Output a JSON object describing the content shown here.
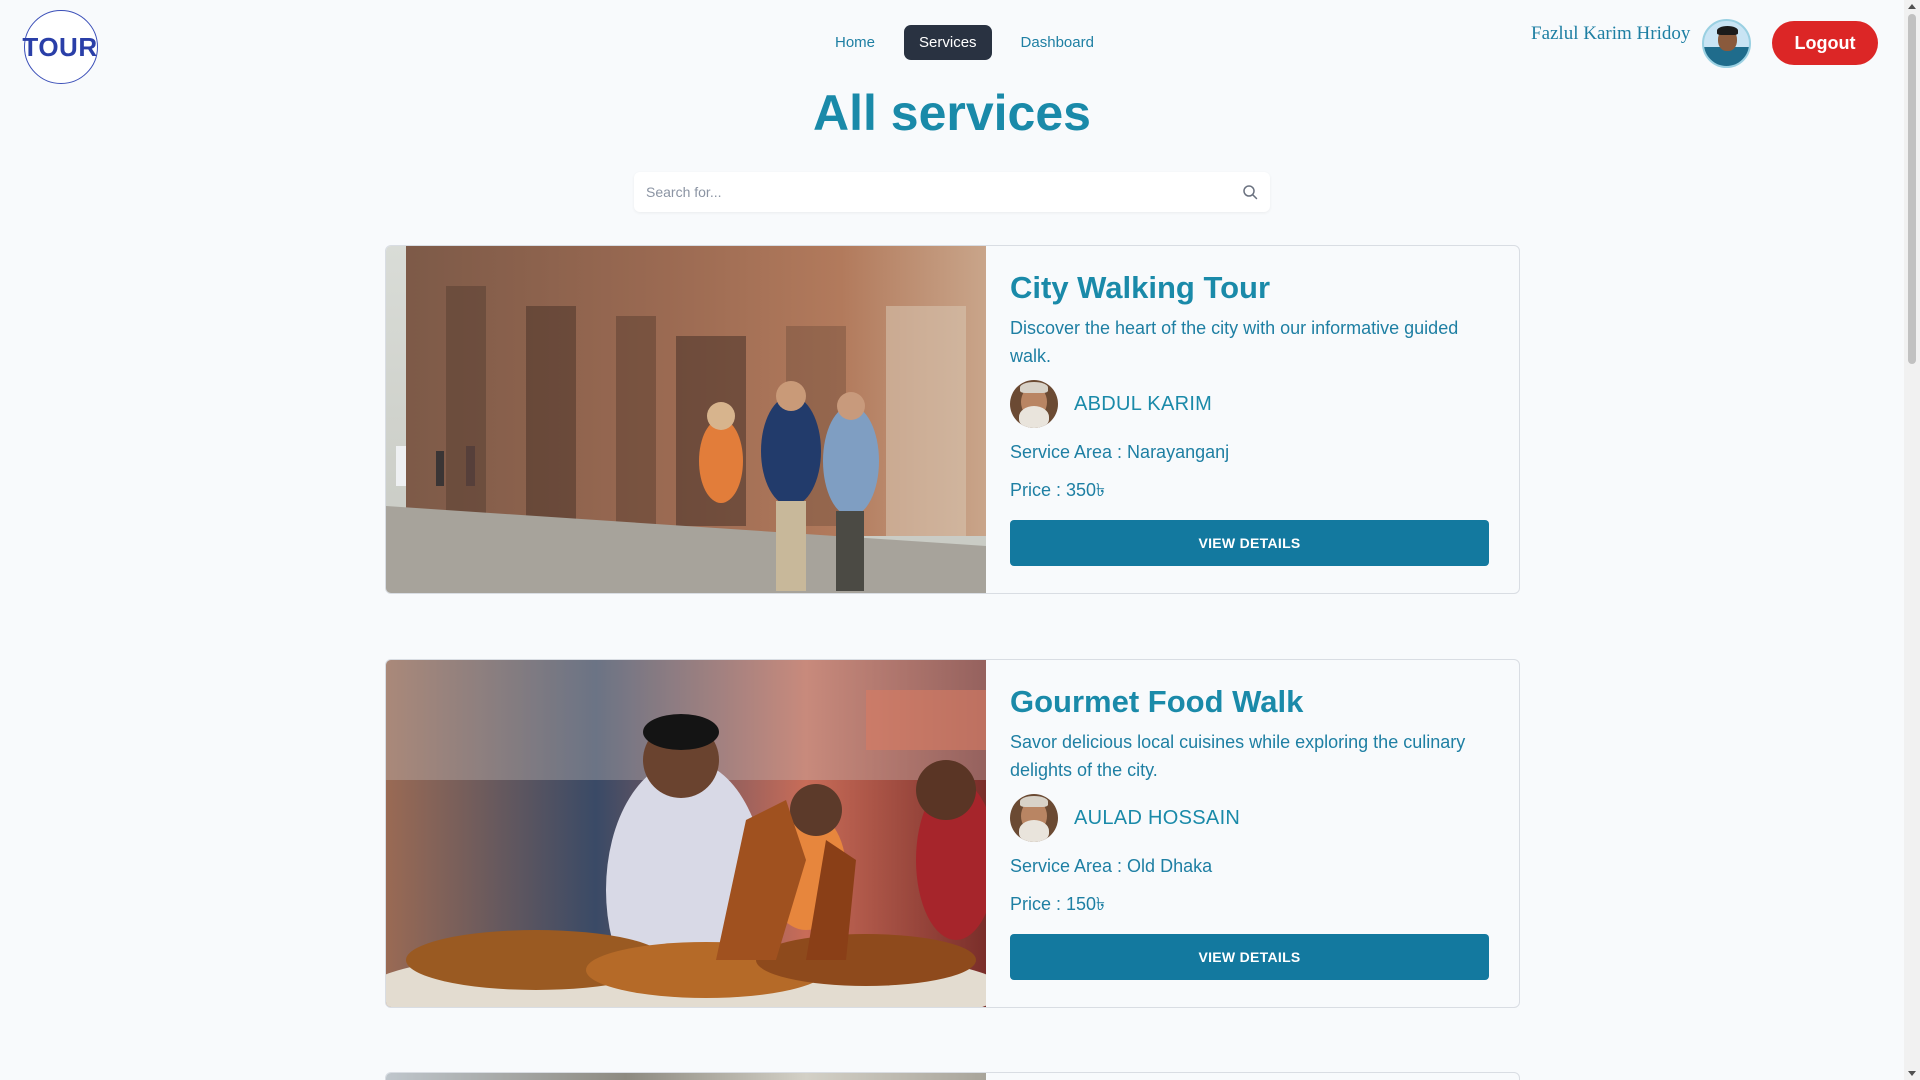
{
  "header": {
    "logo_text": "TOUR",
    "nav": [
      {
        "label": "Home",
        "active": false
      },
      {
        "label": "Services",
        "active": true
      },
      {
        "label": "Dashboard",
        "active": false
      }
    ],
    "user_name": "Fazlul Karim Hridoy",
    "logout_label": "Logout"
  },
  "page_title": "All services",
  "search": {
    "placeholder": "Search for...",
    "value": ""
  },
  "services": [
    {
      "title": "City Walking Tour",
      "description": "Discover the heart of the city with our informative guided walk.",
      "guide_name": "ABDUL KARIM",
      "service_area": "Service Area : Narayanganj",
      "price": "Price : 350৳",
      "button_label": "VIEW DETAILS"
    },
    {
      "title": "Gourmet Food Walk",
      "description": "Savor delicious local cuisines while exploring the culinary delights of the city.",
      "guide_name": "AULAD HOSSAIN",
      "service_area": "Service Area : Old Dhaka",
      "price": "Price : 150৳",
      "button_label": "VIEW DETAILS"
    }
  ],
  "colors": {
    "accent": "#1a8aa9",
    "nav_active_bg": "#293241",
    "logout_bg": "#dc2626",
    "button_bg": "#13799f",
    "page_bg": "#f8fafc"
  },
  "icons": {
    "search": "search-icon"
  }
}
